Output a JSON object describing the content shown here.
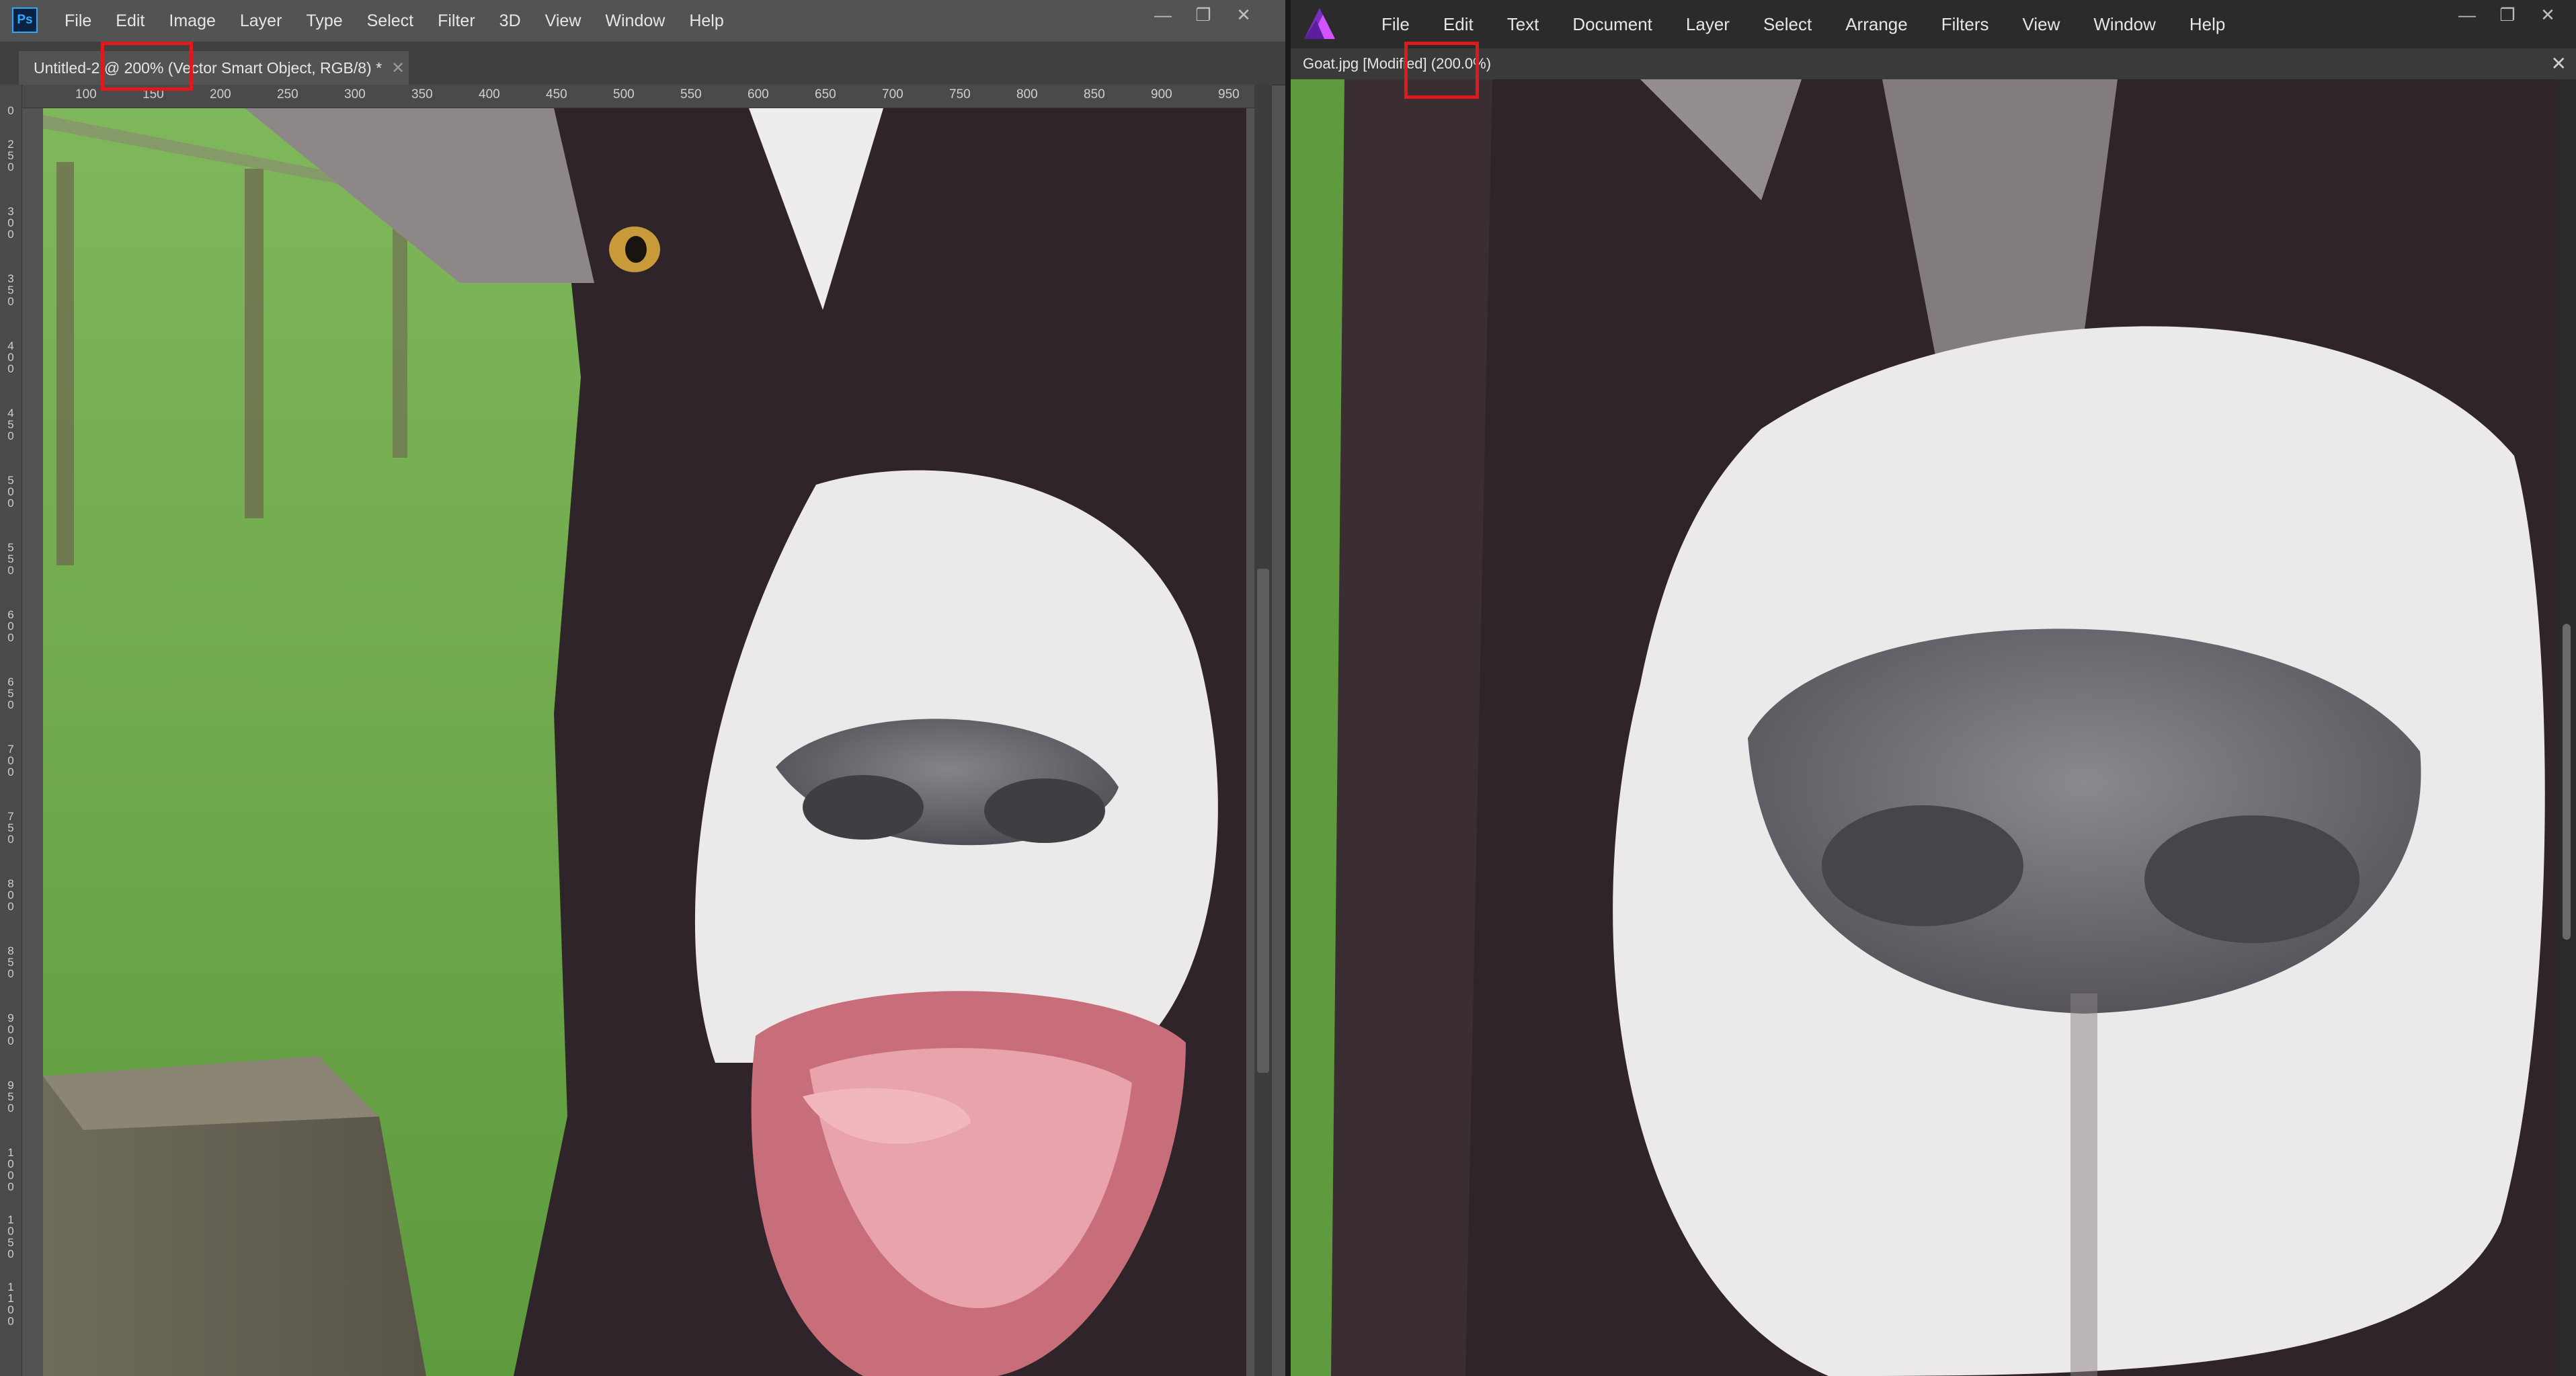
{
  "photoshop": {
    "logo_text": "Ps",
    "menu": [
      "File",
      "Edit",
      "Image",
      "Layer",
      "Type",
      "Select",
      "Filter",
      "3D",
      "View",
      "Window",
      "Help"
    ],
    "window_controls": [
      "—",
      "❐",
      "✕"
    ],
    "doc_tab": "Untitled-2 @ 200% (Vector Smart Object, RGB/8) *",
    "tab_close": "✕",
    "ruler_top": [
      "100",
      "150",
      "200",
      "250",
      "300",
      "350",
      "400",
      "450",
      "500",
      "550",
      "600",
      "650",
      "700",
      "750",
      "800",
      "850",
      "900",
      "950"
    ],
    "ruler_left": [
      "0",
      "250",
      "300",
      "350",
      "400",
      "450",
      "500",
      "550",
      "600",
      "650",
      "700",
      "750",
      "800",
      "850",
      "900",
      "950",
      "1000",
      "1050",
      "1100"
    ]
  },
  "affinity": {
    "menu": [
      "File",
      "Edit",
      "Text",
      "Document",
      "Layer",
      "Select",
      "Arrange",
      "Filters",
      "View",
      "Window",
      "Help"
    ],
    "window_controls": [
      "—",
      "❐",
      "✕"
    ],
    "doc_tab": "Goat.jpg [Modified] (200.0%)",
    "tab_close": "✕"
  },
  "colors": {
    "highlight": "#e0191c",
    "grass": "#6aa84a",
    "goat_dark": "#2f2429",
    "goat_white": "#ece9ea",
    "nose": "#6f6e73"
  }
}
